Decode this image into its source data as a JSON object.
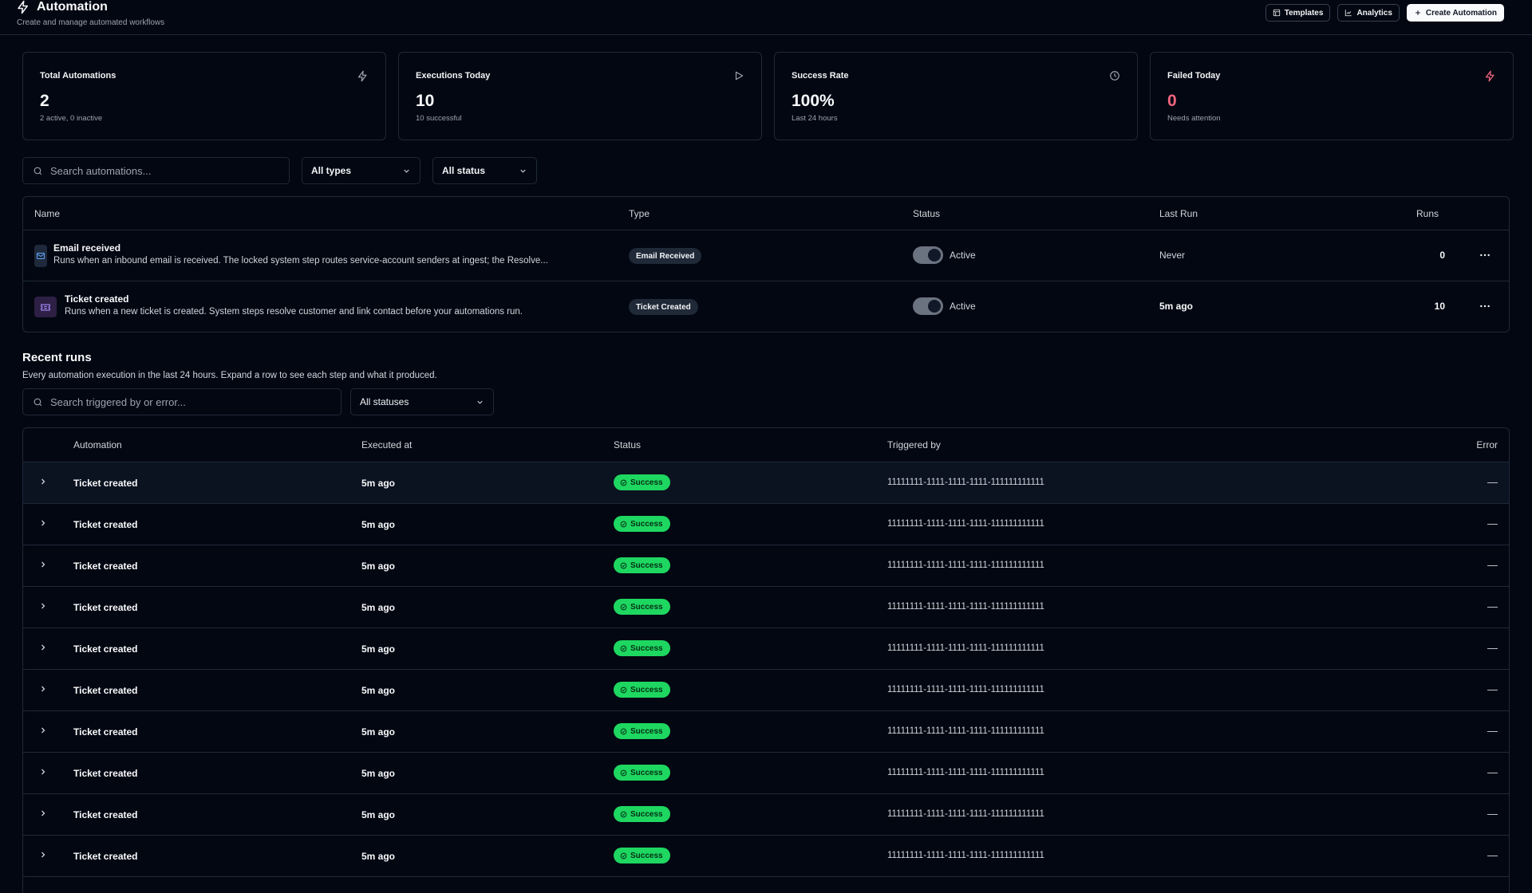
{
  "header": {
    "title": "Automation",
    "subtitle": "Create and manage automated workflows",
    "templates_label": "Templates",
    "analytics_label": "Analytics",
    "create_label": "Create Automation"
  },
  "stats": [
    {
      "label": "Total Automations",
      "value": "2",
      "sub": "2 active, 0 inactive",
      "icon": "bolt-icon"
    },
    {
      "label": "Executions Today",
      "value": "10",
      "sub": "10 successful",
      "icon": "play-icon"
    },
    {
      "label": "Success Rate",
      "value": "100%",
      "sub": "Last 24 hours",
      "icon": "clock-icon"
    },
    {
      "label": "Failed Today",
      "value": "0",
      "sub": "Needs attention",
      "icon": "bolt-icon"
    }
  ],
  "filters": {
    "search_placeholder": "Search automations...",
    "type_selected": "All types",
    "status_selected": "All status"
  },
  "automations": {
    "columns": {
      "name": "Name",
      "type": "Type",
      "status": "Status",
      "last_run": "Last Run",
      "runs": "Runs"
    },
    "rows": [
      {
        "name": "Email received",
        "description": "Runs when an inbound email is received. The locked system step routes service-account senders at ingest; the Resolve...",
        "type": "Email Received",
        "status": "Active",
        "last_run": "Never",
        "runs": "0",
        "icon": "mail-icon"
      },
      {
        "name": "Ticket created",
        "description": "Runs when a new ticket is created. System steps resolve customer and link contact before your automations run.",
        "type": "Ticket Created",
        "status": "Active",
        "last_run": "5m ago",
        "runs": "10",
        "icon": "ticket-icon"
      }
    ]
  },
  "recent_runs": {
    "title": "Recent runs",
    "subtitle": "Every automation execution in the last 24 hours. Expand a row to see each step and what it produced.",
    "search_placeholder": "Search triggered by or error...",
    "status_selected": "All statuses",
    "columns": {
      "automation": "Automation",
      "executed_at": "Executed at",
      "status": "Status",
      "triggered_by": "Triggered by",
      "error": "Error"
    },
    "rows": [
      {
        "automation": "Ticket created",
        "executed_at": "5m ago",
        "status": "Success",
        "triggered_by": "11111111-1111-1111-1111-111111111111",
        "error": "—"
      },
      {
        "automation": "Ticket created",
        "executed_at": "5m ago",
        "status": "Success",
        "triggered_by": "11111111-1111-1111-1111-111111111111",
        "error": "—"
      },
      {
        "automation": "Ticket created",
        "executed_at": "5m ago",
        "status": "Success",
        "triggered_by": "11111111-1111-1111-1111-111111111111",
        "error": "—"
      },
      {
        "automation": "Ticket created",
        "executed_at": "5m ago",
        "status": "Success",
        "triggered_by": "11111111-1111-1111-1111-111111111111",
        "error": "—"
      },
      {
        "automation": "Ticket created",
        "executed_at": "5m ago",
        "status": "Success",
        "triggered_by": "11111111-1111-1111-1111-111111111111",
        "error": "—"
      },
      {
        "automation": "Ticket created",
        "executed_at": "5m ago",
        "status": "Success",
        "triggered_by": "11111111-1111-1111-1111-111111111111",
        "error": "—"
      },
      {
        "automation": "Ticket created",
        "executed_at": "5m ago",
        "status": "Success",
        "triggered_by": "11111111-1111-1111-1111-111111111111",
        "error": "—"
      },
      {
        "automation": "Ticket created",
        "executed_at": "5m ago",
        "status": "Success",
        "triggered_by": "11111111-1111-1111-1111-111111111111",
        "error": "—"
      },
      {
        "automation": "Ticket created",
        "executed_at": "5m ago",
        "status": "Success",
        "triggered_by": "11111111-1111-1111-1111-111111111111",
        "error": "—"
      },
      {
        "automation": "Ticket created",
        "executed_at": "5m ago",
        "status": "Success",
        "triggered_by": "11111111-1111-1111-1111-111111111111",
        "error": "—"
      }
    ]
  },
  "colors": {
    "background": "#030712",
    "border": "#1f2937",
    "success": "#1ed760",
    "danger": "#f0667f"
  }
}
